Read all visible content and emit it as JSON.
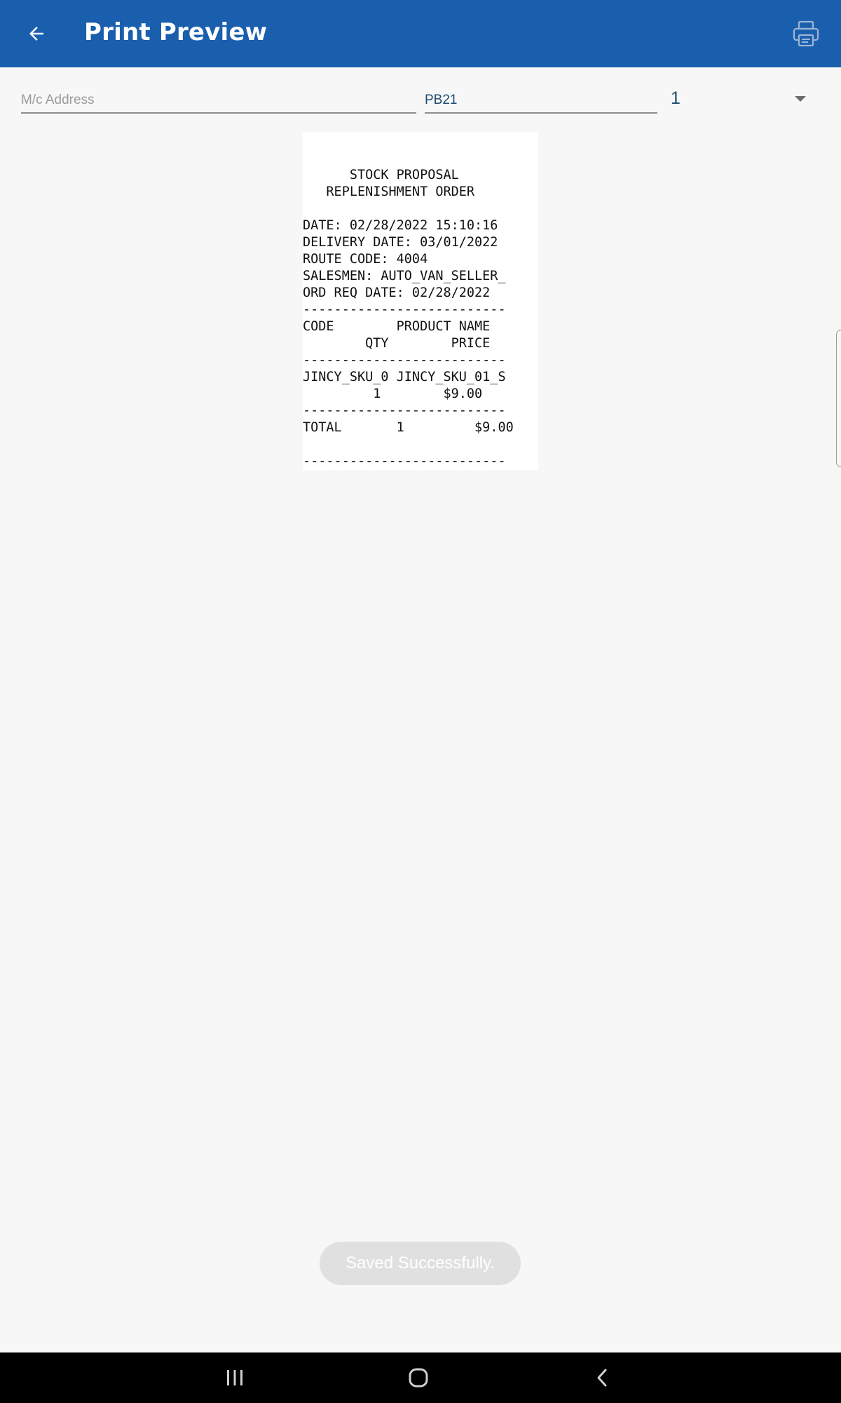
{
  "appbar": {
    "title": "Print Preview",
    "back_icon": "arrow-left-icon",
    "print_icon": "printer-icon",
    "background": "#1a5fae"
  },
  "form": {
    "mac_address": {
      "placeholder": "M/c Address",
      "value": ""
    },
    "printer_code": {
      "value": "PB21"
    },
    "copies": {
      "selected": "1"
    }
  },
  "receipt": {
    "text": "      STOCK PROPOSAL\n   REPLENISHMENT ORDER\n\nDATE: 02/28/2022 15:10:16\nDELIVERY DATE: 03/01/2022\nROUTE CODE: 4004\nSALESMEN: AUTO_VAN_SELLER_\nORD REQ DATE: 02/28/2022\n--------------------------\nCODE        PRODUCT NAME\n        QTY        PRICE\n--------------------------\nJINCY_SKU_0 JINCY_SKU_01_S\n         1        $9.00\n--------------------------\nTOTAL       1         $9.00\n\n--------------------------"
  },
  "toast": {
    "message": "Saved Successfully."
  },
  "navbar": {
    "recents_icon": "recents-icon",
    "home_icon": "home-icon",
    "back_icon": "back-chevron-icon"
  }
}
